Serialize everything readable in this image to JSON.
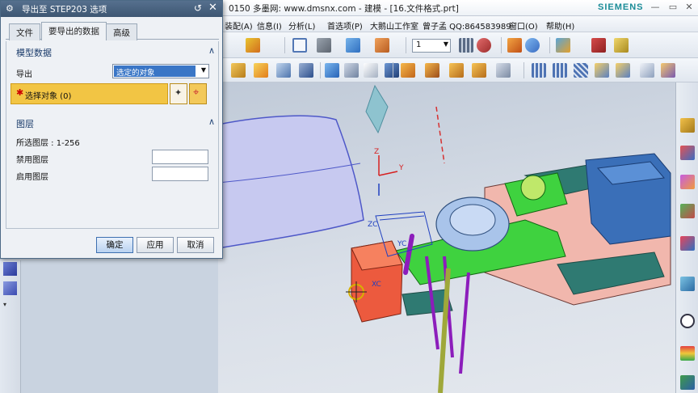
{
  "app": {
    "title": "0150 多墨网: www.dmsnx.com - 建模 - [16.文件格式.prt]",
    "brand": "SIEMENS"
  },
  "menu": [
    "装配(A)",
    "信息(I)",
    "分析(L)",
    "首选项(P)",
    "大鹅山工作室",
    "曾子孟 QQ:864583989",
    "窗口(O)",
    "帮助(H)"
  ],
  "toolbar": {
    "layer_combo": "1"
  },
  "dialog": {
    "title": "导出至 STEP203 选项",
    "tabs": [
      "文件",
      "要导出的数据",
      "高级"
    ],
    "active_tab": 1,
    "model_data": {
      "heading": "模型数据",
      "export_label": "导出",
      "export_value": "选定的对象",
      "select_object_label": "选择对象 (0)"
    },
    "layers": {
      "heading": "图层",
      "selected_layers": "所选图层 : 1-256",
      "disabled_label": "禁用图层",
      "enabled_label": "启用图层",
      "disabled_value": "",
      "enabled_value": ""
    },
    "buttons": {
      "ok": "确定",
      "apply": "应用",
      "cancel": "取消"
    }
  },
  "csys_labels": {
    "z": "Z",
    "y": "Y",
    "zc": "ZC",
    "yc": "YC",
    "xc": "XC"
  },
  "colors": {
    "dialog_title": "#3d5672",
    "selection_highlight": "#f2c544",
    "accent_blue": "#3a76c6"
  }
}
